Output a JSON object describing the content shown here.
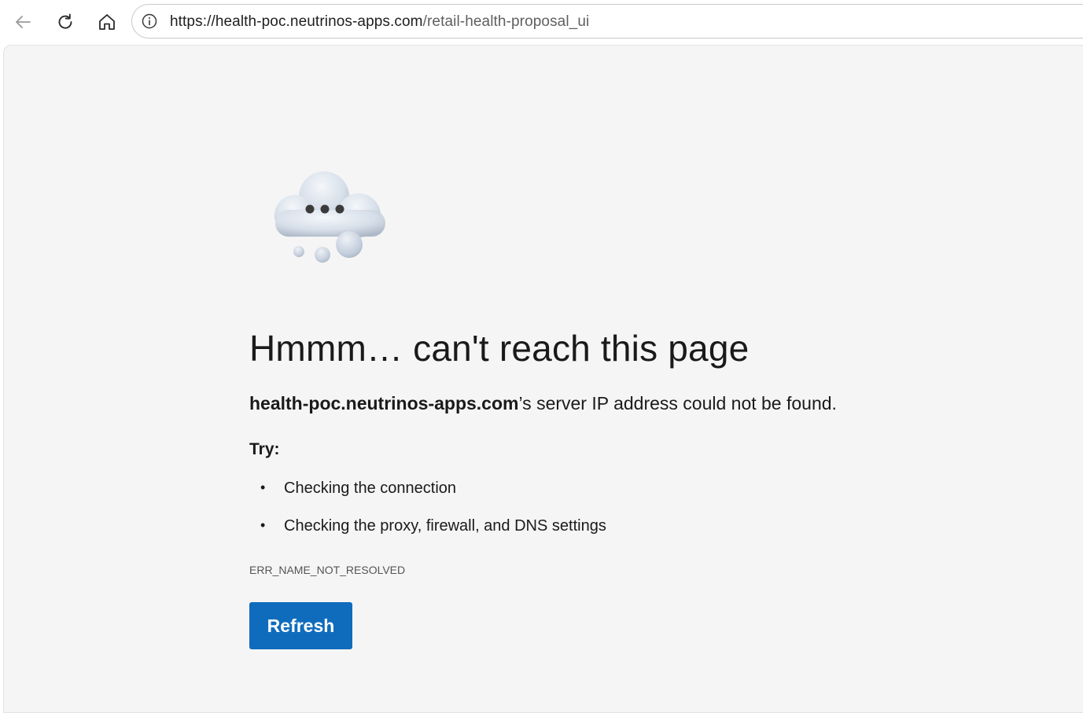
{
  "browser": {
    "url_host": "https://health-poc.neutrinos-apps.com",
    "url_path": "/retail-health-proposal_ui",
    "icons": {
      "back": "back-arrow-icon",
      "reload": "reload-icon",
      "home": "home-icon",
      "info": "info-icon"
    }
  },
  "error_page": {
    "title": "Hmmm… can't reach this page",
    "host": "health-poc.neutrinos-apps.com",
    "message_suffix": "’s server IP address could not be found.",
    "try_label": "Try:",
    "suggestions": [
      "Checking the connection",
      "Checking the proxy, firewall, and DNS settings"
    ],
    "error_code": "ERR_NAME_NOT_RESOLVED",
    "refresh_label": "Refresh",
    "illustration": "thinking-cloud-icon"
  },
  "colors": {
    "accent": "#0f6cbd",
    "page_background": "#f5f5f5"
  }
}
